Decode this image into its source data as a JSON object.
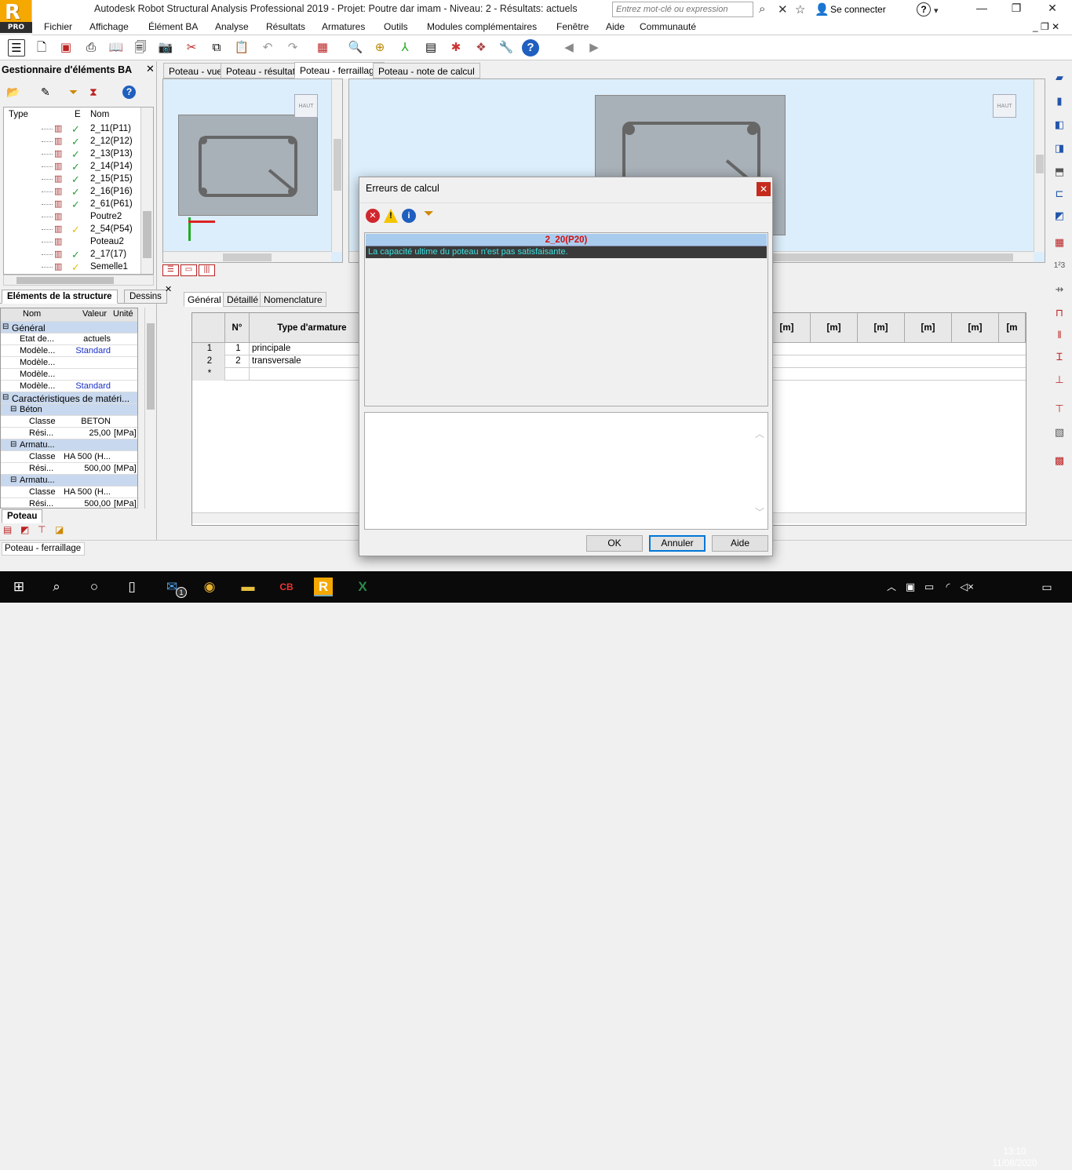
{
  "window": {
    "title": "Autodesk Robot Structural Analysis Professional 2019 - Projet: Poutre dar imam - Niveau: 2 - Résultats: actuels",
    "search_placeholder": "Entrez mot-clé ou expression",
    "connect": "Se connecter",
    "logo_letter": "R",
    "logo_sub": "PRO"
  },
  "menu": [
    "Fichier",
    "Affichage",
    "Élément BA",
    "Analyse",
    "Résultats",
    "Armatures",
    "Outils",
    "Modules complémentaires",
    "Fenêtre",
    "Aide",
    "Communauté"
  ],
  "left_panel": {
    "title": "Gestionnaire d'éléments BA",
    "col_type": "Type",
    "col_e": "E",
    "col_nom": "Nom",
    "tree": [
      {
        "name": "2_11(P11)",
        "status": "ok"
      },
      {
        "name": "2_12(P12)",
        "status": "ok"
      },
      {
        "name": "2_13(P13)",
        "status": "ok"
      },
      {
        "name": "2_14(P14)",
        "status": "ok"
      },
      {
        "name": "2_15(P15)",
        "status": "ok"
      },
      {
        "name": "2_16(P16)",
        "status": "ok"
      },
      {
        "name": "2_61(P61)",
        "status": "ok"
      },
      {
        "name": "Poutre2",
        "status": "none"
      },
      {
        "name": "2_54(P54)",
        "status": "warn"
      },
      {
        "name": "Poteau2",
        "status": "none"
      },
      {
        "name": "2_17(17)",
        "status": "ok"
      },
      {
        "name": "Semelle1",
        "status": "warn"
      }
    ],
    "tab1": "Eléments de la structure",
    "tab2": "Dessins",
    "props_headers": {
      "nom": "Nom",
      "valeur": "Valeur",
      "unite": "Unité"
    },
    "props": [
      {
        "kind": "hdr",
        "label": "Général"
      },
      {
        "kind": "row",
        "nom": "Etat de...",
        "valeur": "actuels",
        "unite": "",
        "blue": false
      },
      {
        "kind": "row",
        "nom": "Modèle...",
        "valeur": "Standard",
        "unite": "",
        "blue": true
      },
      {
        "kind": "row",
        "nom": "Modèle...",
        "valeur": "",
        "unite": "",
        "blue": false
      },
      {
        "kind": "row",
        "nom": "Modèle...",
        "valeur": "",
        "unite": "",
        "blue": false
      },
      {
        "kind": "row",
        "nom": "Modèle...",
        "valeur": "Standard",
        "unite": "",
        "blue": true
      },
      {
        "kind": "hdr",
        "label": "Caractéristiques de matéri..."
      },
      {
        "kind": "sub",
        "label": "Béton"
      },
      {
        "kind": "row2",
        "nom": "Classe",
        "valeur": "BETON",
        "unite": ""
      },
      {
        "kind": "row2",
        "nom": "Rési...",
        "valeur": "25,00",
        "unite": "[MPa]"
      },
      {
        "kind": "sub",
        "label": "Armatu..."
      },
      {
        "kind": "row2",
        "nom": "Classe",
        "valeur": "HA 500 (H...",
        "unite": ""
      },
      {
        "kind": "row2",
        "nom": "Rési...",
        "valeur": "500,00",
        "unite": "[MPa]"
      },
      {
        "kind": "sub",
        "label": "Armatu..."
      },
      {
        "kind": "row2",
        "nom": "Classe",
        "valeur": "HA 500 (H...",
        "unite": ""
      },
      {
        "kind": "row2",
        "nom": "Rési...",
        "valeur": "500,00",
        "unite": "[MPa]"
      }
    ],
    "bottom_tab": "Poteau"
  },
  "center_tabs": [
    "Poteau - vue",
    "Poteau - résultats",
    "Poteau - ferraillage",
    "Poteau - note de calcul"
  ],
  "view_cube_label": "HAUT",
  "lower_tabs": [
    "Général",
    "Détaillé",
    "Nomenclature"
  ],
  "grid": {
    "headers": [
      "N°",
      "Type d'armature",
      "[m]",
      "[m]",
      "[m]",
      "[m]",
      "[m]",
      "[m"
    ],
    "rows": [
      {
        "idx": "1",
        "n": "1",
        "type": "principale"
      },
      {
        "idx": "2",
        "n": "2",
        "type": "transversale"
      },
      {
        "idx": "*",
        "n": "",
        "type": ""
      }
    ]
  },
  "status_text": "Poteau - ferraillage",
  "dialog": {
    "title": "Erreurs de calcul",
    "group": "2_20(P20)",
    "message": "La capacité ultime du poteau n'est pas satisfaisante.",
    "ok": "OK",
    "cancel": "Annuler",
    "help": "Aide"
  },
  "taskbar": {
    "time": "13:10",
    "date": "11/08/2020",
    "mail_badge": "1"
  },
  "colors": {
    "accent": "#f5a800",
    "error_group": "#d01010",
    "message_bg": "#3a3a3a",
    "message_fg": "#3fe0e0"
  }
}
